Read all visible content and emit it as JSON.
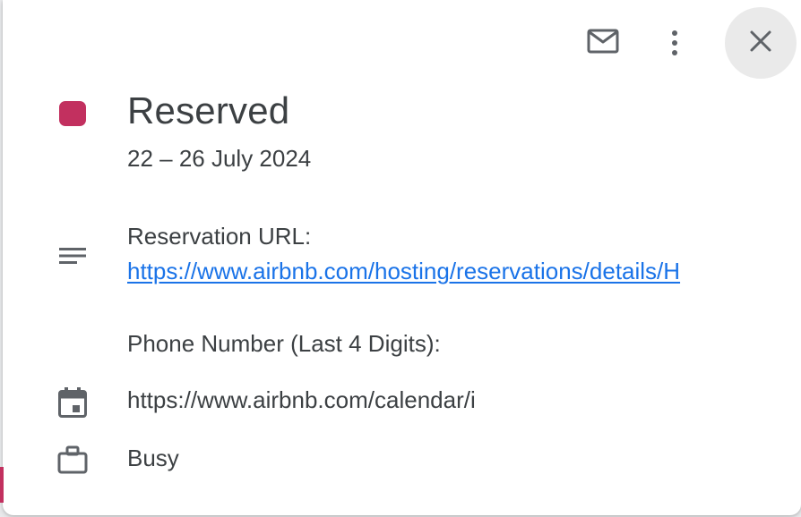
{
  "event": {
    "title": "Reserved",
    "date_range": "22 – 26 July 2024",
    "color": "#c2305f"
  },
  "toolbar": {
    "icons": [
      "mail-icon",
      "more-vert-icon",
      "close-icon"
    ]
  },
  "description": {
    "reservation_label": "Reservation URL:",
    "reservation_link": "https://www.airbnb.com/hosting/reservations/details/H",
    "phone_label": "Phone Number (Last 4 Digits):"
  },
  "calendar": {
    "url": "https://www.airbnb.com/calendar/i"
  },
  "availability": {
    "status": "Busy"
  },
  "colors": {
    "link": "#1a73e8",
    "text": "#3c4043",
    "icon": "#5f6368"
  }
}
